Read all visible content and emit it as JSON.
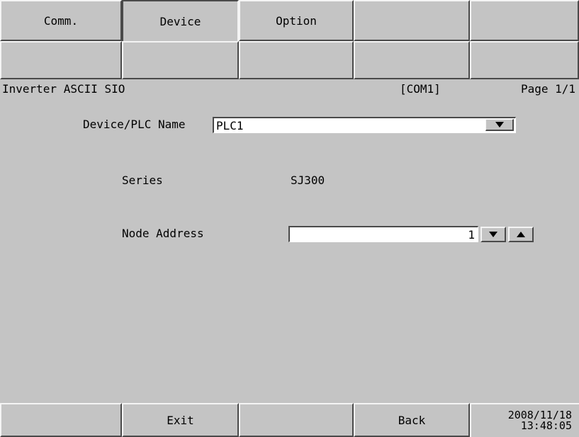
{
  "tabs_row1": [
    "Comm.",
    "Device",
    "Option",
    "",
    ""
  ],
  "selected_tab": "Device",
  "tabs_row2": [
    "",
    "",
    "",
    "",
    ""
  ],
  "info": {
    "driver": "Inverter ASCII SIO",
    "port": "[COM1]",
    "page": "Page 1/1"
  },
  "device_plc": {
    "label": "Device/PLC Name",
    "value": "PLC1",
    "dropdown_icon": "triangle-down-icon"
  },
  "series": {
    "label": "Series",
    "value": "SJ300"
  },
  "node_address": {
    "label": "Node Address",
    "value": "1",
    "down_icon": "triangle-down-icon",
    "up_icon": "triangle-up-icon"
  },
  "bottom": {
    "buttons": [
      "",
      "Exit",
      "",
      "Back"
    ],
    "date": "2008/11/18",
    "time": "13:48:05"
  }
}
